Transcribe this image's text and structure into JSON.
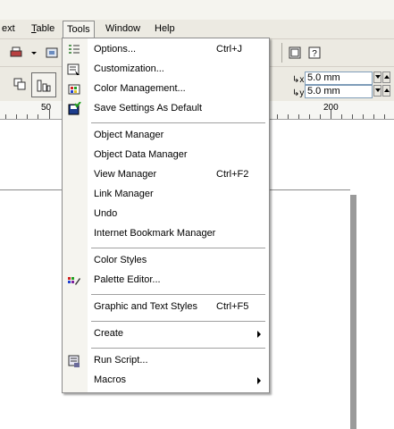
{
  "menubar": {
    "items": [
      {
        "label": "ext"
      },
      {
        "label": "Table"
      },
      {
        "label": "Tools"
      },
      {
        "label": "Window"
      },
      {
        "label": "Help"
      }
    ]
  },
  "toolbar": {
    "nudge_x": "5.0 mm",
    "nudge_y": "5.0 mm"
  },
  "ruler": {
    "labels": [
      "50",
      "200"
    ]
  },
  "tools_menu": {
    "groups": [
      [
        {
          "label": "Options...",
          "shortcut": "Ctrl+J",
          "icon": "options-icon"
        },
        {
          "label": "Customization...",
          "shortcut": "",
          "icon": "customization-icon"
        },
        {
          "label": "Color Management...",
          "shortcut": "",
          "icon": "color-management-icon"
        },
        {
          "label": "Save Settings As Default",
          "shortcut": "",
          "icon": "save-settings-icon"
        }
      ],
      [
        {
          "label": "Object Manager",
          "shortcut": ""
        },
        {
          "label": "Object Data Manager",
          "shortcut": ""
        },
        {
          "label": "View Manager",
          "shortcut": "Ctrl+F2"
        },
        {
          "label": "Link Manager",
          "shortcut": ""
        },
        {
          "label": "Undo",
          "shortcut": ""
        },
        {
          "label": "Internet Bookmark Manager",
          "shortcut": ""
        }
      ],
      [
        {
          "label": "Color Styles",
          "shortcut": ""
        },
        {
          "label": "Palette Editor...",
          "shortcut": "",
          "icon": "palette-editor-icon"
        }
      ],
      [
        {
          "label": "Graphic and Text Styles",
          "shortcut": "Ctrl+F5"
        }
      ],
      [
        {
          "label": "Create",
          "shortcut": "",
          "submenu": true
        }
      ],
      [
        {
          "label": "Run Script...",
          "shortcut": "",
          "icon": "run-script-icon"
        },
        {
          "label": "Macros",
          "shortcut": "",
          "submenu": true
        }
      ]
    ]
  }
}
